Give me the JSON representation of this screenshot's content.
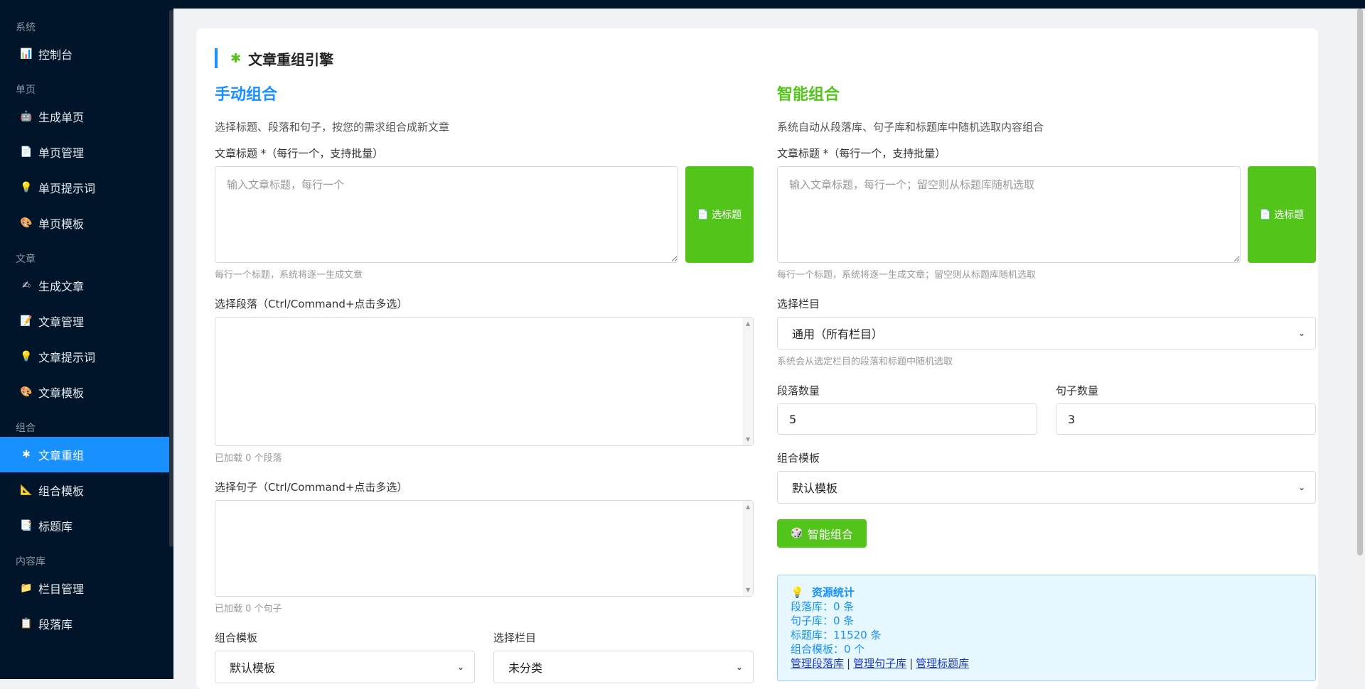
{
  "sidebar": {
    "groups": [
      {
        "label": "系统",
        "items": [
          {
            "icon": "📊",
            "label": "控制台"
          }
        ]
      },
      {
        "label": "单页",
        "items": [
          {
            "icon": "🤖",
            "label": "生成单页"
          },
          {
            "icon": "📄",
            "label": "单页管理"
          },
          {
            "icon": "💡",
            "label": "单页提示词"
          },
          {
            "icon": "🎨",
            "label": "单页模板"
          }
        ]
      },
      {
        "label": "文章",
        "items": [
          {
            "icon": "✍",
            "label": "生成文章"
          },
          {
            "icon": "📝",
            "label": "文章管理"
          },
          {
            "icon": "💡",
            "label": "文章提示词"
          },
          {
            "icon": "🎨",
            "label": "文章模板"
          }
        ]
      },
      {
        "label": "组合",
        "items": [
          {
            "icon": "✱",
            "label": "文章重组"
          },
          {
            "icon": "📐",
            "label": "组合模板"
          },
          {
            "icon": "📑",
            "label": "标题库"
          }
        ]
      },
      {
        "label": "内容库",
        "items": [
          {
            "icon": "📁",
            "label": "栏目管理"
          },
          {
            "icon": "📋",
            "label": "段落库"
          }
        ]
      }
    ]
  },
  "card": {
    "title": "文章重组引擎",
    "title_icon": "✱"
  },
  "manual": {
    "title": "手动组合",
    "desc": "选择标题、段落和句子，按您的需求组合成新文章",
    "title_label": "文章标题 *（每行一个，支持批量）",
    "title_placeholder": "输入文章标题，每行一个",
    "pick_button": "选标题",
    "title_hint": "每行一个标题，系统将逐一生成文章",
    "para_label": "选择段落（Ctrl/Command+点击多选）",
    "para_hint": "已加载 0 个段落",
    "sent_label": "选择句子（Ctrl/Command+点击多选）",
    "sent_hint": "已加载 0 个句子",
    "template_label": "组合模板",
    "template_value": "默认模板",
    "column_label": "选择栏目",
    "column_value": "未分类"
  },
  "smart": {
    "title": "智能组合",
    "desc": "系统自动从段落库、句子库和标题库中随机选取内容组合",
    "title_label": "文章标题 *（每行一个，支持批量）",
    "title_placeholder": "输入文章标题，每行一个；留空则从标题库随机选取",
    "pick_button": "选标题",
    "title_hint": "每行一个标题，系统将逐一生成文章；留空则从标题库随机选取",
    "column_label": "选择栏目",
    "column_value": "通用（所有栏目）",
    "column_hint": "系统会从选定栏目的段落和标题中随机选取",
    "para_count_label": "段落数量",
    "para_count_value": "5",
    "sent_count_label": "句子数量",
    "sent_count_value": "3",
    "template_label": "组合模板",
    "template_value": "默认模板",
    "submit_button": "智能组合"
  },
  "stats": {
    "title": "资源统计",
    "para": "段落库：0 条",
    "sent": "句子库：0 条",
    "titles": "标题库：11520 条",
    "templates": "组合模板：0 个",
    "link_para": "管理段落库",
    "link_sent": "管理句子库",
    "link_titles": "管理标题库"
  }
}
